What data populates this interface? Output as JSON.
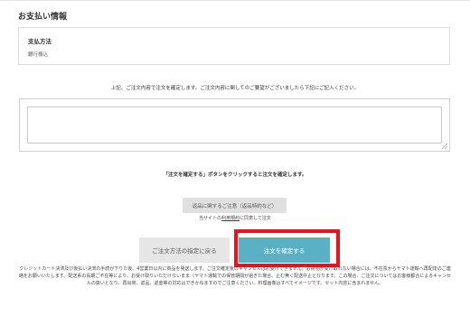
{
  "section_title": "お支払い情報",
  "payment": {
    "label": "支払方法",
    "value": "銀行振込"
  },
  "instructions": "上記、ご注文内容で注文を確定します。ご注文内容に関してのご要望がございましたら下記にご記入ください。",
  "comment": {
    "value": "",
    "placeholder": ""
  },
  "confirm_notice": "「注文を確定する」ボタンをクリックすると注文を確定します。",
  "returns_button": "返品に関するご注意（返品特約など）",
  "terms": {
    "prefix": "当サイトの",
    "link": "利用規約",
    "suffix": "に同意して注文"
  },
  "back_button": "ご注文方法の指定に戻る",
  "confirm_button": "注文を確定する",
  "fine_print": "クレジットカード決済及び後払い決済の手続が下りた後、4営業日以内に商品を発送します。ご注文確定後のキャンセルはお受けできません。お荷物が受け取れない場合には、不在票からヤマト運輸へ再配達のご連絡をお願いいたします。配送系の長期ご不在等により、お受け取りいただけないまま（ヤマト運輸での保管期間が過ぎた場合、止む無く配送中止となります。この場合、ご注文についてはお客様都合によるキャンセルの扱いとなり、再出荷、返品、返金等の対応はできかねますのでご注意ください。料理画像はすべてイメージです。セット内容に含まれません。",
  "colors": {
    "confirm_button_bg": "#5ab1c6",
    "highlight_border": "#e8141d",
    "secondary_button_bg": "#e6e6e6"
  }
}
